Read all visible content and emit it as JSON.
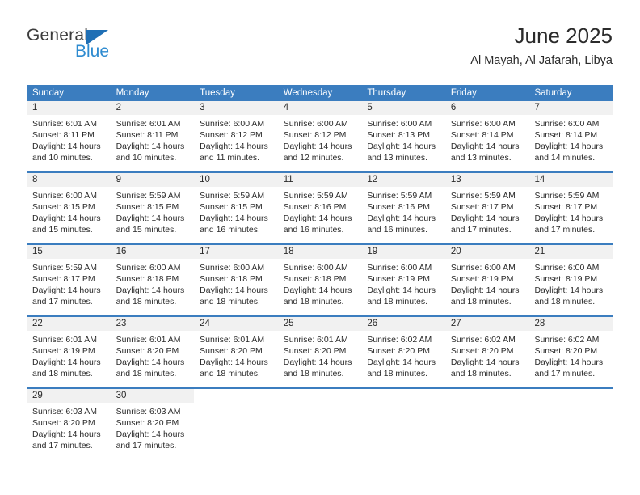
{
  "brand": {
    "name_part1": "General",
    "name_part2": "Blue",
    "color_dark": "#3d3d3d",
    "color_blue": "#2e8bd0",
    "triangle_color": "#1f6fb5"
  },
  "header": {
    "title": "June 2025",
    "subtitle": "Al Mayah, Al Jafarah, Libya"
  },
  "theme": {
    "header_bg": "#3b7dbf",
    "header_text": "#ffffff",
    "daynum_bg": "#f1f1f1",
    "body_text": "#2b2b2b"
  },
  "weekdays": [
    "Sunday",
    "Monday",
    "Tuesday",
    "Wednesday",
    "Thursday",
    "Friday",
    "Saturday"
  ],
  "weeks": [
    {
      "days": [
        {
          "num": "1",
          "sunrise": "Sunrise: 6:01 AM",
          "sunset": "Sunset: 8:11 PM",
          "daylight": "Daylight: 14 hours and 10 minutes."
        },
        {
          "num": "2",
          "sunrise": "Sunrise: 6:01 AM",
          "sunset": "Sunset: 8:11 PM",
          "daylight": "Daylight: 14 hours and 10 minutes."
        },
        {
          "num": "3",
          "sunrise": "Sunrise: 6:00 AM",
          "sunset": "Sunset: 8:12 PM",
          "daylight": "Daylight: 14 hours and 11 minutes."
        },
        {
          "num": "4",
          "sunrise": "Sunrise: 6:00 AM",
          "sunset": "Sunset: 8:12 PM",
          "daylight": "Daylight: 14 hours and 12 minutes."
        },
        {
          "num": "5",
          "sunrise": "Sunrise: 6:00 AM",
          "sunset": "Sunset: 8:13 PM",
          "daylight": "Daylight: 14 hours and 13 minutes."
        },
        {
          "num": "6",
          "sunrise": "Sunrise: 6:00 AM",
          "sunset": "Sunset: 8:14 PM",
          "daylight": "Daylight: 14 hours and 13 minutes."
        },
        {
          "num": "7",
          "sunrise": "Sunrise: 6:00 AM",
          "sunset": "Sunset: 8:14 PM",
          "daylight": "Daylight: 14 hours and 14 minutes."
        }
      ]
    },
    {
      "days": [
        {
          "num": "8",
          "sunrise": "Sunrise: 6:00 AM",
          "sunset": "Sunset: 8:15 PM",
          "daylight": "Daylight: 14 hours and 15 minutes."
        },
        {
          "num": "9",
          "sunrise": "Sunrise: 5:59 AM",
          "sunset": "Sunset: 8:15 PM",
          "daylight": "Daylight: 14 hours and 15 minutes."
        },
        {
          "num": "10",
          "sunrise": "Sunrise: 5:59 AM",
          "sunset": "Sunset: 8:15 PM",
          "daylight": "Daylight: 14 hours and 16 minutes."
        },
        {
          "num": "11",
          "sunrise": "Sunrise: 5:59 AM",
          "sunset": "Sunset: 8:16 PM",
          "daylight": "Daylight: 14 hours and 16 minutes."
        },
        {
          "num": "12",
          "sunrise": "Sunrise: 5:59 AM",
          "sunset": "Sunset: 8:16 PM",
          "daylight": "Daylight: 14 hours and 16 minutes."
        },
        {
          "num": "13",
          "sunrise": "Sunrise: 5:59 AM",
          "sunset": "Sunset: 8:17 PM",
          "daylight": "Daylight: 14 hours and 17 minutes."
        },
        {
          "num": "14",
          "sunrise": "Sunrise: 5:59 AM",
          "sunset": "Sunset: 8:17 PM",
          "daylight": "Daylight: 14 hours and 17 minutes."
        }
      ]
    },
    {
      "days": [
        {
          "num": "15",
          "sunrise": "Sunrise: 5:59 AM",
          "sunset": "Sunset: 8:17 PM",
          "daylight": "Daylight: 14 hours and 17 minutes."
        },
        {
          "num": "16",
          "sunrise": "Sunrise: 6:00 AM",
          "sunset": "Sunset: 8:18 PM",
          "daylight": "Daylight: 14 hours and 18 minutes."
        },
        {
          "num": "17",
          "sunrise": "Sunrise: 6:00 AM",
          "sunset": "Sunset: 8:18 PM",
          "daylight": "Daylight: 14 hours and 18 minutes."
        },
        {
          "num": "18",
          "sunrise": "Sunrise: 6:00 AM",
          "sunset": "Sunset: 8:18 PM",
          "daylight": "Daylight: 14 hours and 18 minutes."
        },
        {
          "num": "19",
          "sunrise": "Sunrise: 6:00 AM",
          "sunset": "Sunset: 8:19 PM",
          "daylight": "Daylight: 14 hours and 18 minutes."
        },
        {
          "num": "20",
          "sunrise": "Sunrise: 6:00 AM",
          "sunset": "Sunset: 8:19 PM",
          "daylight": "Daylight: 14 hours and 18 minutes."
        },
        {
          "num": "21",
          "sunrise": "Sunrise: 6:00 AM",
          "sunset": "Sunset: 8:19 PM",
          "daylight": "Daylight: 14 hours and 18 minutes."
        }
      ]
    },
    {
      "days": [
        {
          "num": "22",
          "sunrise": "Sunrise: 6:01 AM",
          "sunset": "Sunset: 8:19 PM",
          "daylight": "Daylight: 14 hours and 18 minutes."
        },
        {
          "num": "23",
          "sunrise": "Sunrise: 6:01 AM",
          "sunset": "Sunset: 8:20 PM",
          "daylight": "Daylight: 14 hours and 18 minutes."
        },
        {
          "num": "24",
          "sunrise": "Sunrise: 6:01 AM",
          "sunset": "Sunset: 8:20 PM",
          "daylight": "Daylight: 14 hours and 18 minutes."
        },
        {
          "num": "25",
          "sunrise": "Sunrise: 6:01 AM",
          "sunset": "Sunset: 8:20 PM",
          "daylight": "Daylight: 14 hours and 18 minutes."
        },
        {
          "num": "26",
          "sunrise": "Sunrise: 6:02 AM",
          "sunset": "Sunset: 8:20 PM",
          "daylight": "Daylight: 14 hours and 18 minutes."
        },
        {
          "num": "27",
          "sunrise": "Sunrise: 6:02 AM",
          "sunset": "Sunset: 8:20 PM",
          "daylight": "Daylight: 14 hours and 18 minutes."
        },
        {
          "num": "28",
          "sunrise": "Sunrise: 6:02 AM",
          "sunset": "Sunset: 8:20 PM",
          "daylight": "Daylight: 14 hours and 17 minutes."
        }
      ]
    },
    {
      "days": [
        {
          "num": "29",
          "sunrise": "Sunrise: 6:03 AM",
          "sunset": "Sunset: 8:20 PM",
          "daylight": "Daylight: 14 hours and 17 minutes."
        },
        {
          "num": "30",
          "sunrise": "Sunrise: 6:03 AM",
          "sunset": "Sunset: 8:20 PM",
          "daylight": "Daylight: 14 hours and 17 minutes."
        },
        {
          "num": "",
          "sunrise": "",
          "sunset": "",
          "daylight": ""
        },
        {
          "num": "",
          "sunrise": "",
          "sunset": "",
          "daylight": ""
        },
        {
          "num": "",
          "sunrise": "",
          "sunset": "",
          "daylight": ""
        },
        {
          "num": "",
          "sunrise": "",
          "sunset": "",
          "daylight": ""
        },
        {
          "num": "",
          "sunrise": "",
          "sunset": "",
          "daylight": ""
        }
      ]
    }
  ]
}
